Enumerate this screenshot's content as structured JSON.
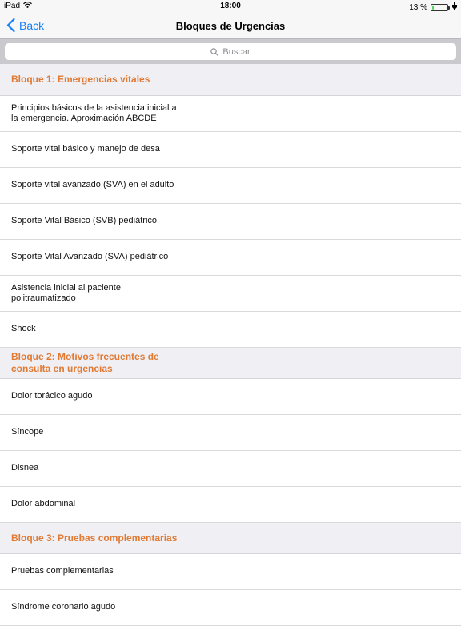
{
  "status_bar": {
    "device": "iPad",
    "time": "18:00",
    "battery_pct": "13 %",
    "battery_level": 0.13
  },
  "nav": {
    "back_label": "Back",
    "title": "Bloques de Urgencias"
  },
  "search": {
    "placeholder": "Buscar"
  },
  "sections": [
    {
      "title": "Bloque 1: Emergencias vitales",
      "items": [
        "Principios básicos de la asistencia inicial a la emergencia. Aproximación ABCDE",
        "Soporte vital básico y manejo de desa",
        "Soporte vital avanzado (SVA) en el adulto",
        "Soporte Vital Básico (SVB) pediátrico",
        "Soporte Vital Avanzado (SVA) pediátrico",
        "Asistencia inicial al paciente politraumatizado",
        "Shock"
      ]
    },
    {
      "title": "Bloque 2: Motivos frecuentes de consulta en urgencias",
      "items": [
        "Dolor torácico agudo",
        "Síncope",
        "Disnea",
        "Dolor abdominal"
      ]
    },
    {
      "title": "Bloque 3: Pruebas complementarias",
      "items": [
        "Pruebas complementarias",
        "Síndrome coronario agudo"
      ]
    }
  ],
  "colors": {
    "accent": "#157efb",
    "section_header_text": "#e07a34",
    "battery_fill": "#4cd964"
  }
}
